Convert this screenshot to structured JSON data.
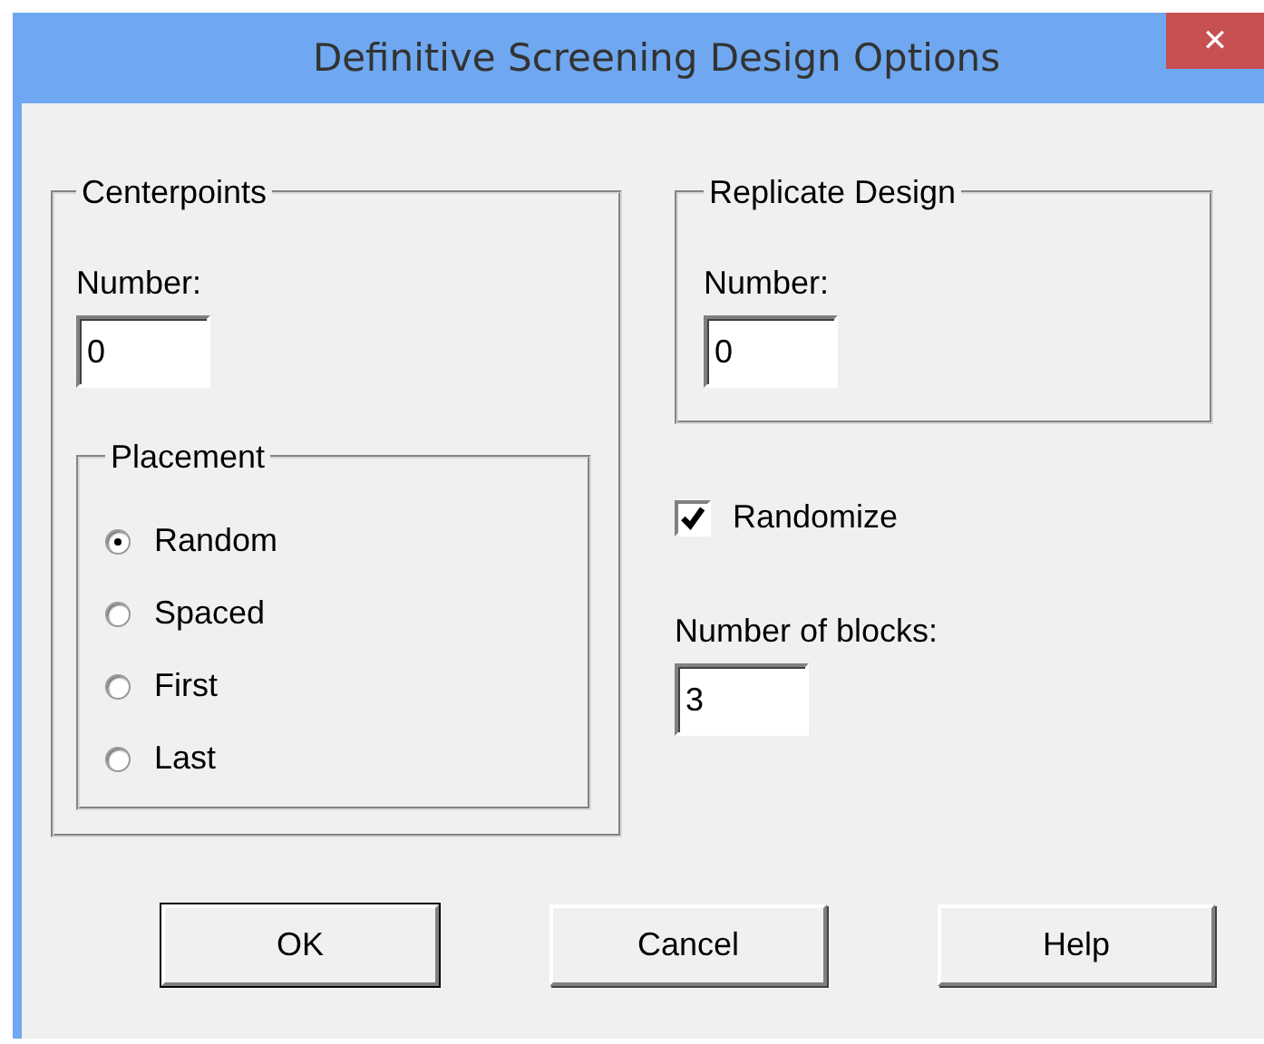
{
  "window": {
    "title": "Definitive Screening Design Options",
    "close": "✕"
  },
  "centerpoints": {
    "title": "Centerpoints",
    "number_label": "Number:",
    "number_value": "0",
    "placement": {
      "title": "Placement",
      "options": [
        {
          "label": "Random",
          "selected": true
        },
        {
          "label": "Spaced",
          "selected": false
        },
        {
          "label": "First",
          "selected": false
        },
        {
          "label": "Last",
          "selected": false
        }
      ]
    }
  },
  "replicate_design": {
    "title": "Replicate Design",
    "number_label": "Number:",
    "number_value": "0"
  },
  "randomize": {
    "label": "Randomize",
    "checked": true
  },
  "blocks": {
    "label": "Number of blocks:",
    "value": "3"
  },
  "buttons": [
    {
      "label": "OK",
      "default": true
    },
    {
      "label": "Cancel",
      "default": false
    },
    {
      "label": "Help",
      "default": false
    }
  ]
}
